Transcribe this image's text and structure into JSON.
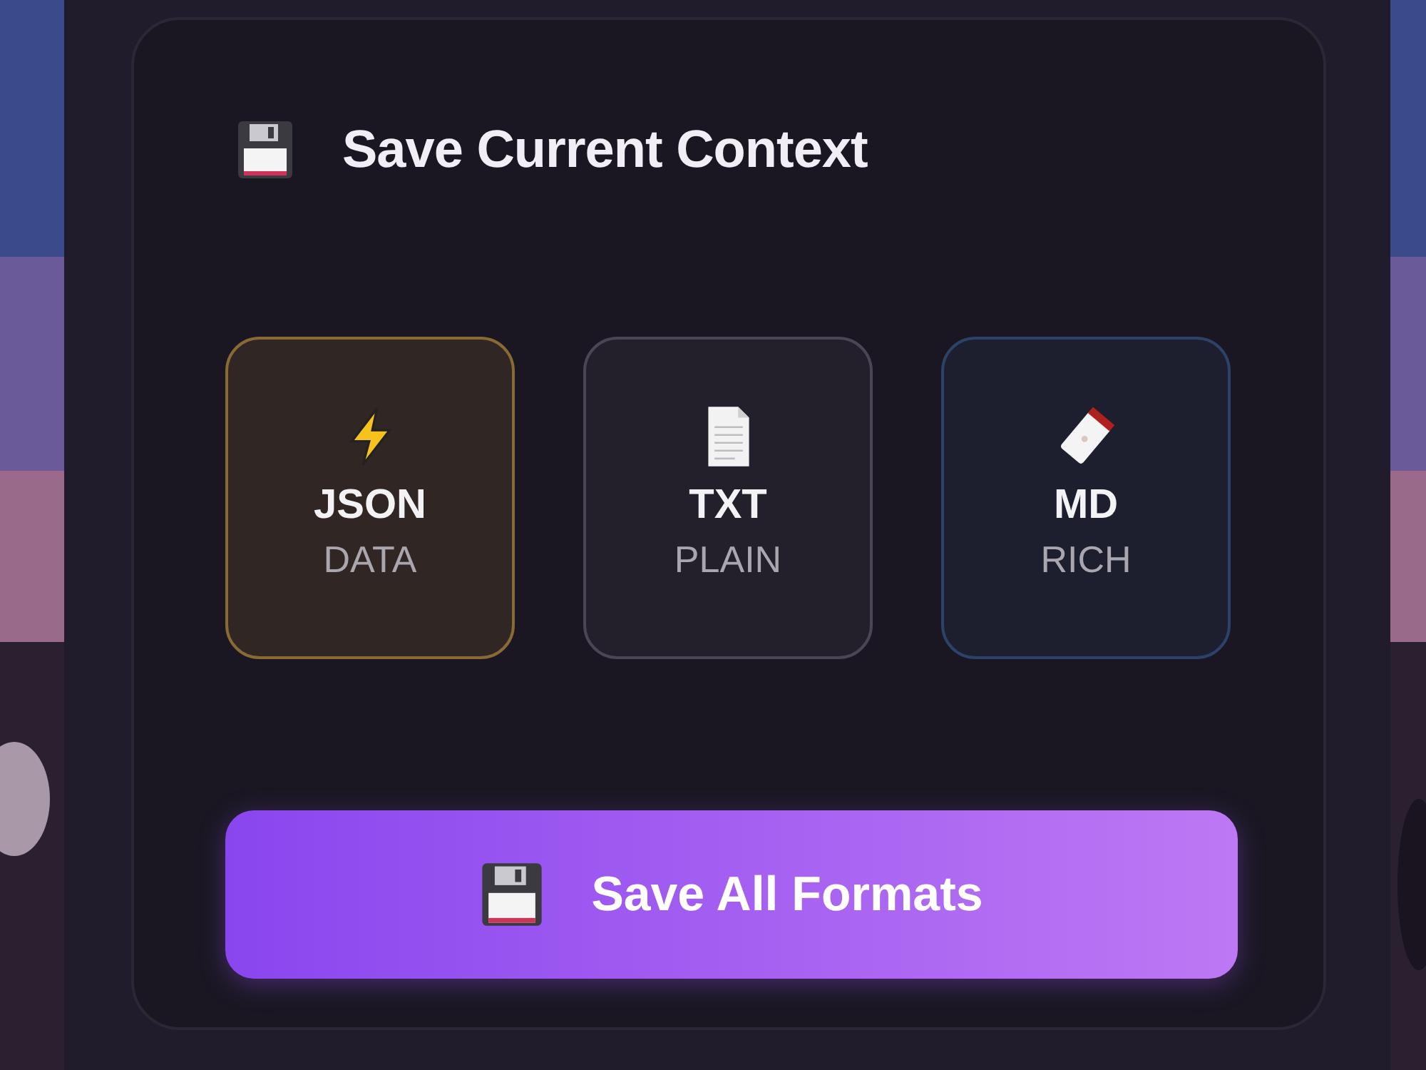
{
  "title": "Save Current Context",
  "formats": [
    {
      "kind": "bolt",
      "label": "JSON",
      "sublabel": "DATA",
      "color": "#8a6a34"
    },
    {
      "kind": "document",
      "label": "TXT",
      "sublabel": "PLAIN",
      "color": "#4a4656"
    },
    {
      "kind": "tag",
      "label": "MD",
      "sublabel": "RICH",
      "color": "#2c4266"
    }
  ],
  "save_button": {
    "label": "Save All Formats"
  }
}
